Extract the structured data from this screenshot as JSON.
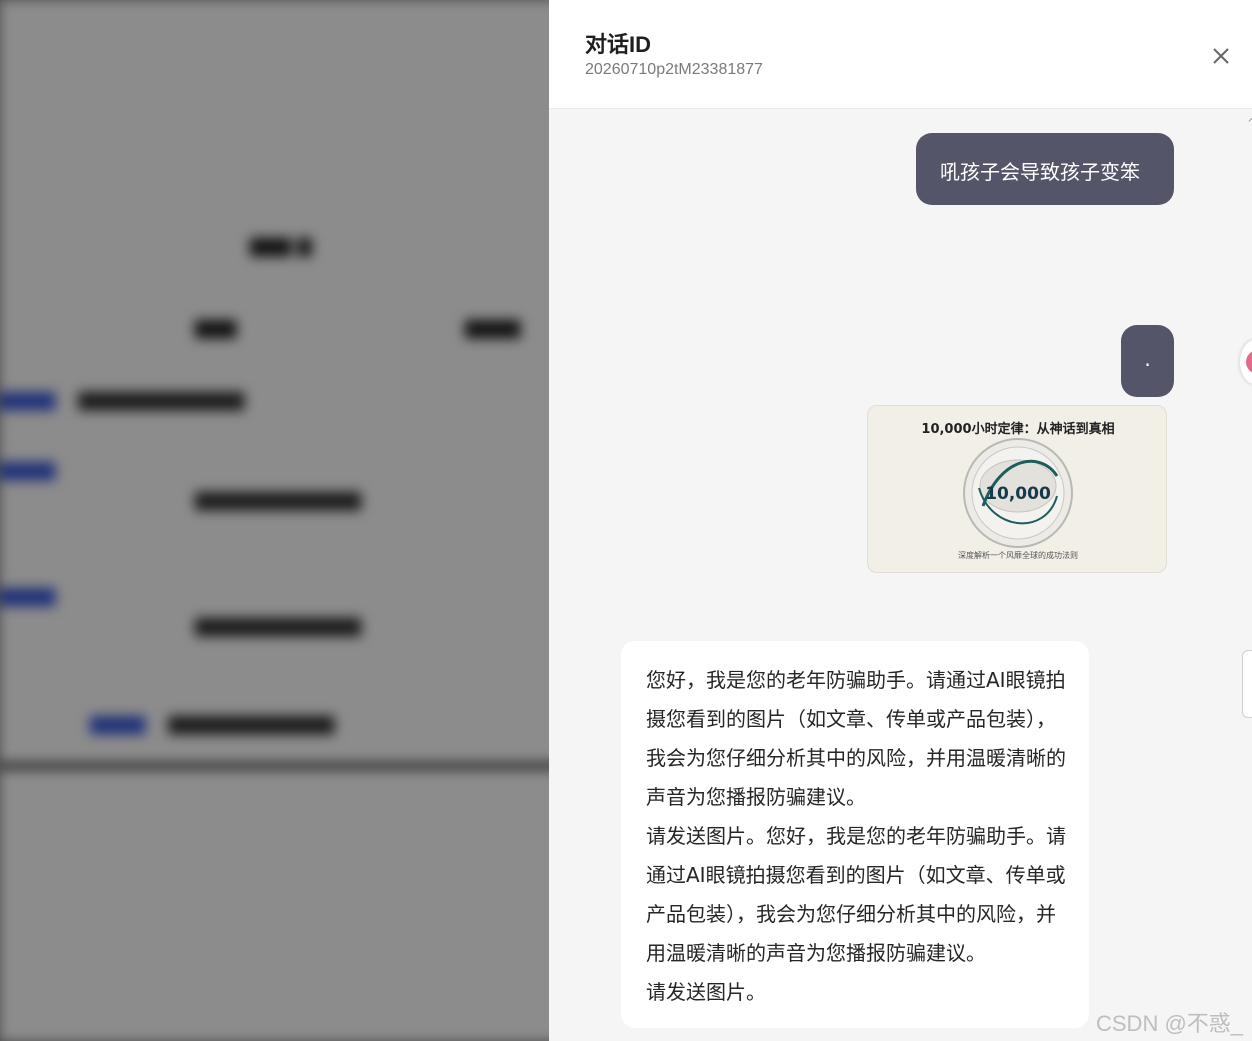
{
  "drawer": {
    "title": "对话ID",
    "conversation_id": "20260710p2tM23381877"
  },
  "messages": [
    {
      "role": "user",
      "type": "text",
      "text": "吼孩子会导致孩子变笨"
    },
    {
      "role": "user",
      "type": "text",
      "text": "."
    },
    {
      "role": "user",
      "type": "image",
      "image_title": "10,000小时定律：从神话到真相",
      "image_number": "10,000",
      "image_caption": "深度解析一个风靡全球的成功法则"
    },
    {
      "role": "assistant",
      "type": "text",
      "text": "您好，我是您的老年防骗助手。请通过AI眼镜拍摄您看到的图片（如文章、传单或产品包装），我会为您仔细分析其中的风险，并用温暖清晰的声音为您播报防骗建议。",
      "text2": "请发送图片。您好，我是您的老年防骗助手。请通过AI眼镜拍摄您看到的图片（如文章、传单或产品包装），我会为您仔细分析其中的风险，并用温暖清晰的声音为您播报防骗建议。",
      "text3": "请发送图片。"
    }
  ],
  "watermark": "CSDN @不惑_",
  "icons": {
    "close": "close-icon"
  },
  "colors": {
    "user_bubble": "#545569",
    "assistant_bubble": "#ffffff",
    "drawer_bg": "#f5f5f5"
  }
}
